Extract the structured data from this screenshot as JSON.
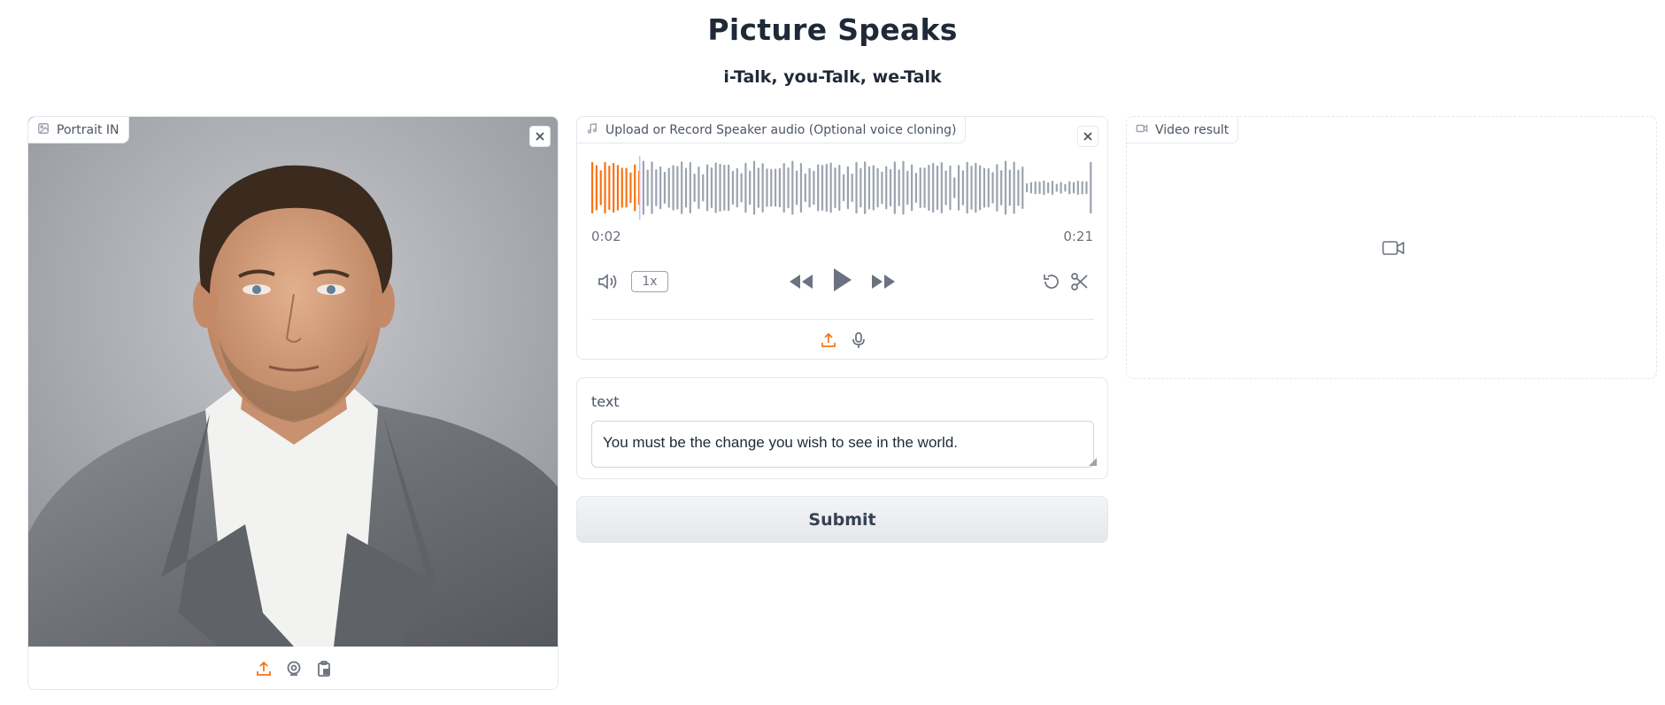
{
  "page": {
    "title": "Picture Speaks",
    "subtitle": "i-Talk, you-Talk, we-Talk"
  },
  "portrait": {
    "label": "Portrait IN",
    "icons": [
      "image-icon",
      "close-icon",
      "upload-icon",
      "webcam-icon",
      "clipboard-icon"
    ]
  },
  "audio": {
    "label": "Upload or Record Speaker audio (Optional voice cloning)",
    "current_time": "0:02",
    "duration": "0:21",
    "progress": 0.095,
    "playback_rate": "1x",
    "icons": [
      "music-icon",
      "close-icon",
      "volume-icon",
      "rewind-icon",
      "play-icon",
      "fast-forward-icon",
      "reset-icon",
      "trim-icon",
      "upload-icon",
      "microphone-icon"
    ]
  },
  "text": {
    "label": "text",
    "value": "You must be the change you wish to see in the world."
  },
  "submit": {
    "label": "Submit"
  },
  "video": {
    "label": "Video result",
    "icons": [
      "video-icon",
      "video-placeholder-icon"
    ]
  },
  "colors": {
    "accent": "#f97316",
    "wave_inactive": "#9ca3af",
    "border": "#e5e7eb"
  }
}
